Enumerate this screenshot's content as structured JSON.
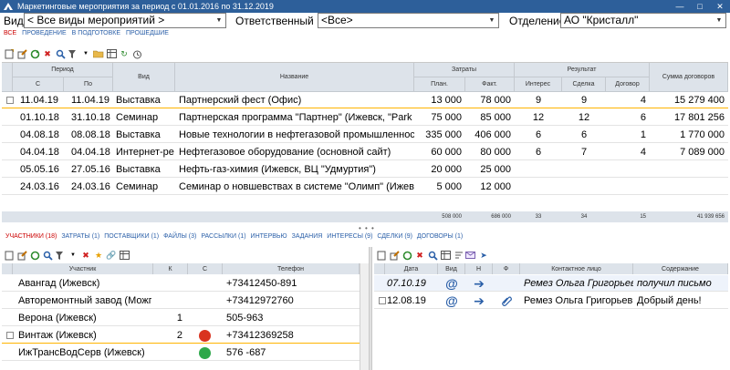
{
  "window": {
    "title": "Маркетинговые мероприятия за период с 01.01.2016 по 31.12.2019",
    "minimize_icon": "minimize-icon",
    "maximize_icon": "maximize-icon",
    "close_icon": "close-icon"
  },
  "filters": {
    "type_label": "Вид",
    "type_value": "< Все виды мероприятий >",
    "responsible_label": "Ответственный",
    "responsible_value": "<Все>",
    "department_label": "Отделение",
    "department_value": "АО \"Кристалл\""
  },
  "top_tabs": [
    {
      "label": "Все",
      "active": true
    },
    {
      "label": "Проведение",
      "active": false
    },
    {
      "label": "В подготовке",
      "active": false
    },
    {
      "label": "Прошедшие",
      "active": false
    }
  ],
  "events_table": {
    "headers": {
      "period": "Период",
      "from": "С",
      "to": "По",
      "type": "Вид",
      "name": "Название",
      "costs": "Затраты",
      "plan": "План.",
      "fact": "Факт.",
      "result": "Результат",
      "interest": "Интерес",
      "deal": "Сделка",
      "contract": "Договор",
      "contracts_sum": "Сумма договоров"
    },
    "rows": [
      {
        "from": "11.04.19",
        "to": "11.04.19",
        "type": "Выставка",
        "name": "Партнерский фест (Офис)",
        "plan": "13 000",
        "fact": "78 000",
        "interest": "9",
        "deal": "9",
        "contract": "4",
        "sum": "15 279 400"
      },
      {
        "from": "01.10.18",
        "to": "31.10.18",
        "type": "Семинар",
        "name": "Партнерская программа \"Партнер\" (Ижевск, \"Park In\")",
        "plan": "75 000",
        "fact": "85 000",
        "interest": "12",
        "deal": "12",
        "contract": "6",
        "sum": "17 801 256"
      },
      {
        "from": "04.08.18",
        "to": "08.08.18",
        "type": "Выставка",
        "name": "Новые технологии в нефтегазовой промышленности (г.",
        "plan": "335 000",
        "fact": "406 000",
        "interest": "6",
        "deal": "6",
        "contract": "1",
        "sum": "1 770 000"
      },
      {
        "from": "04.04.18",
        "to": "04.04.18",
        "type": "Интернет-ре",
        "name": "Нефтегазовое оборудование (основной сайт)",
        "plan": "60 000",
        "fact": "80 000",
        "interest": "6",
        "deal": "7",
        "contract": "4",
        "sum": "7 089 000"
      },
      {
        "from": "05.05.16",
        "to": "27.05.16",
        "type": "Выставка",
        "name": "Нефть-газ-химия (Ижевск, ВЦ \"Удмуртия\")",
        "plan": "20 000",
        "fact": "25 000",
        "interest": "",
        "deal": "",
        "contract": "",
        "sum": ""
      },
      {
        "from": "24.03.16",
        "to": "24.03.16",
        "type": "Семинар",
        "name": "Семинар о новшевствах в системе \"Олимп\" (Ижевск)",
        "plan": "5 000",
        "fact": "12 000",
        "interest": "",
        "deal": "",
        "contract": "",
        "sum": ""
      }
    ],
    "totals": {
      "plan": "508 000",
      "fact": "686 000",
      "interest": "33",
      "deal": "34",
      "contract": "15",
      "sum": "41 939 656"
    }
  },
  "bottom_tabs": [
    {
      "label": "Участники (18)",
      "active": true
    },
    {
      "label": "Затраты (1)",
      "active": false
    },
    {
      "label": "Поставщики (1)",
      "active": false
    },
    {
      "label": "Файлы (3)",
      "active": false
    },
    {
      "label": "Рассылки (1)",
      "active": false
    },
    {
      "label": "Интервью",
      "active": false
    },
    {
      "label": "Задания",
      "active": false
    },
    {
      "label": "Интересы (9)",
      "active": false
    },
    {
      "label": "Сделки (9)",
      "active": false
    },
    {
      "label": "Договоры (1)",
      "active": false
    }
  ],
  "participants": {
    "headers": {
      "name": "Участник",
      "k": "К",
      "c": "С",
      "phone": "Телефон"
    },
    "rows": [
      {
        "name": "Авангад (Ижевск)",
        "k": "",
        "dot": "",
        "phone": "+73412450-891"
      },
      {
        "name": "Авторемонтный завод (Можга)",
        "k": "",
        "dot": "",
        "phone": "+73412972760"
      },
      {
        "name": "Верона (Ижевск)",
        "k": "1",
        "dot": "",
        "phone": "505-963"
      },
      {
        "name": "Винтаж (Ижевск)",
        "k": "2",
        "dot": "#d9331f",
        "phone": "+73412369258"
      },
      {
        "name": "ИжТрансВодСерв (Ижевск)",
        "k": "",
        "dot": "#2ea84a",
        "phone": "576 -687"
      }
    ]
  },
  "contacts": {
    "headers": {
      "date": "Дата",
      "type": "Вид",
      "n": "Н",
      "f": "Ф",
      "person": "Контактное лицо",
      "content": "Содержание"
    },
    "rows": [
      {
        "date": "07.10.19",
        "type_icon": "email-icon",
        "n_icon": "arrow-right-icon",
        "f_icon": "",
        "person": "Ремез Ольга Григорьевна",
        "content": "получил письмо",
        "italic": true
      },
      {
        "date": "12.08.19",
        "type_icon": "email-icon",
        "n_icon": "arrow-right-icon",
        "f_icon": "paperclip-icon",
        "person": "Ремез Ольга Григорьевна",
        "content": "Добрый день!",
        "italic": false
      }
    ]
  }
}
